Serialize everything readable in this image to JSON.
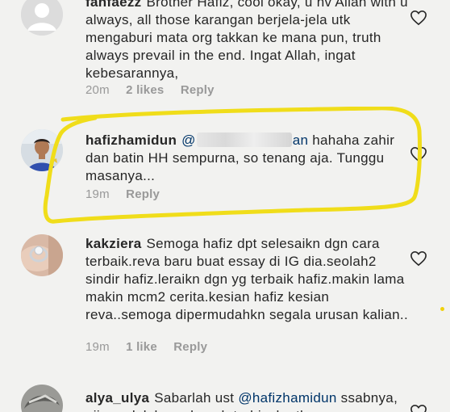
{
  "highlight_color": "#f0dd1a",
  "heart_icon": "heart-outline-icon",
  "comments": [
    {
      "username": "fanfaezz",
      "text": "Brother Hafiz, cool okay, u hv Allah with u always, all those karangan berjela-jela utk mengaburi mata org takkan ke mana pun, truth always prevail in the end. Ingat Allah, ingat kebesarannya,",
      "time": "20m",
      "likes": "2 likes",
      "reply": "Reply"
    },
    {
      "username": "hafizhamidun",
      "mention_prefix": "@",
      "mention_suffix": "an",
      "text": " hahaha zahir dan batin HH sempurna, so tenang aja. Tunggu masanya...",
      "time": "19m",
      "reply": "Reply"
    },
    {
      "username": "kakziera",
      "text": "Semoga hafiz dpt selesaikn dgn cara terbaik.reva baru buat essay di IG dia.seolah2 sindir hafiz.leraikn dgn yg terbaik hafiz.makin lama makin mcm2 cerita.kesian hafiz kesian reva..semoga dipermudahkn segala urusan kalian..",
      "time": "19m",
      "likes": "1 like",
      "reply": "Reply"
    },
    {
      "username": "alya_ulya",
      "text": "Sabarlah ust ",
      "mention": "@hafizhamidun",
      "text2": " ssabnya, ujian adalah madrasah tarbiyah utk"
    }
  ]
}
